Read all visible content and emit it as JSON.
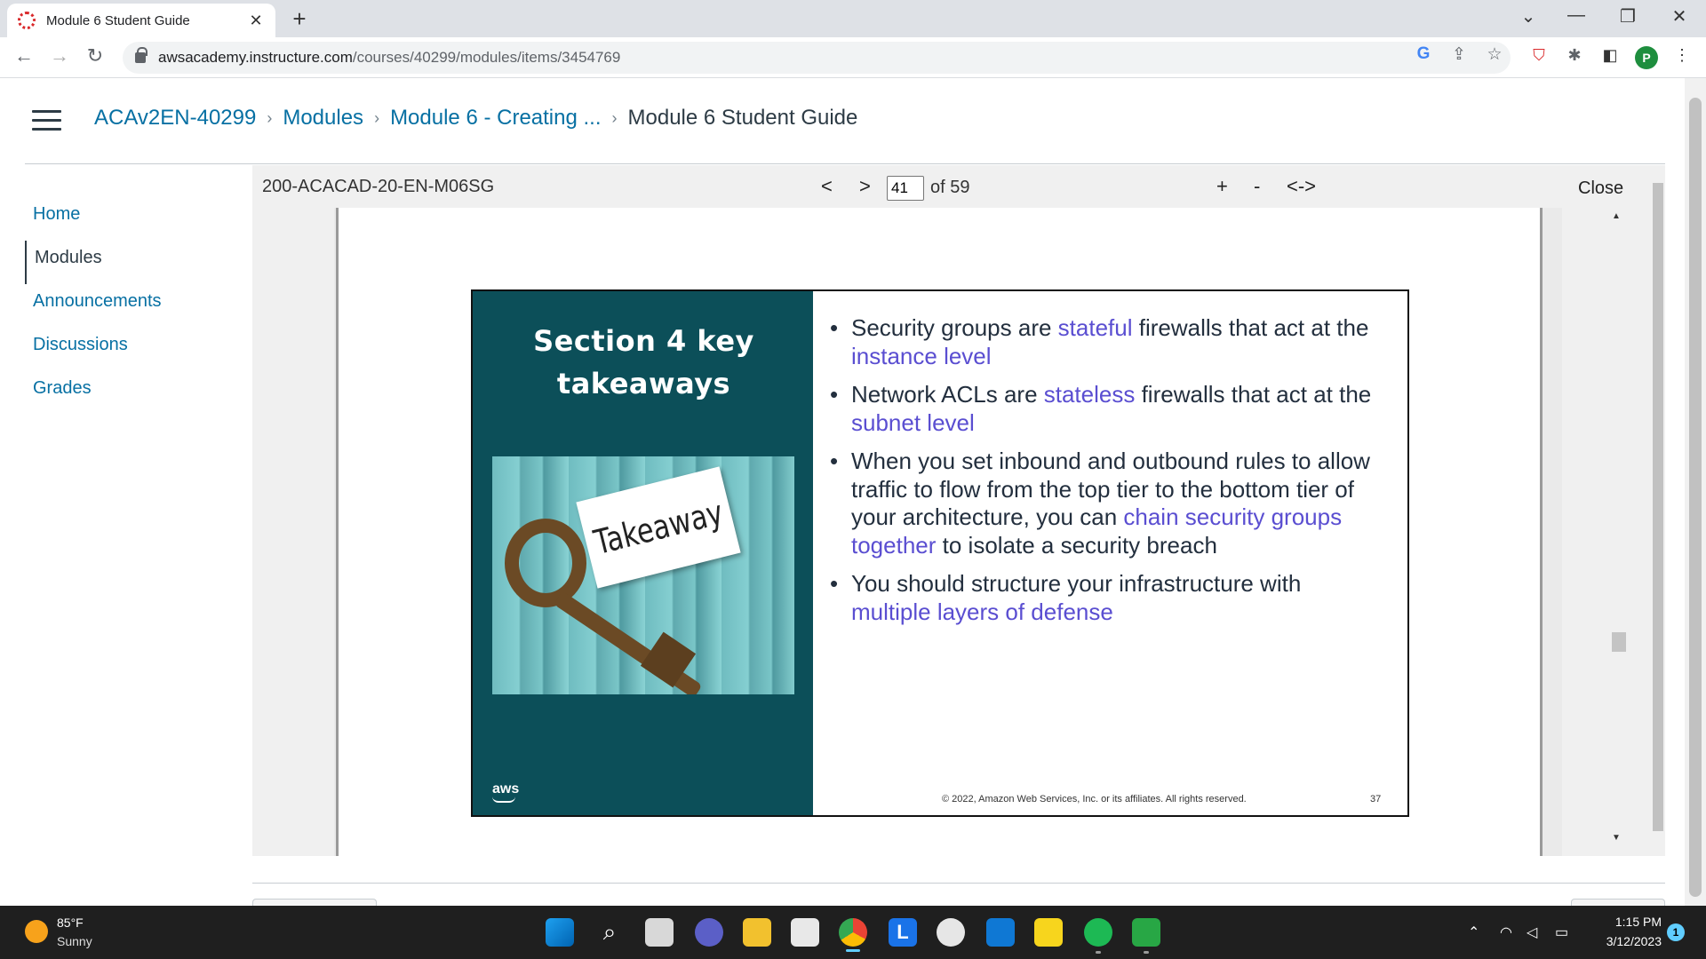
{
  "browser": {
    "tab_title": "Module 6 Student Guide",
    "tab_close": "✕",
    "new_tab": "+",
    "url_host": "awsacademy.instructure.com",
    "url_path": "/courses/40299/modules/items/3454769",
    "profile_initial": "P"
  },
  "breadcrumb": {
    "course": "ACAv2EN-40299",
    "modules": "Modules",
    "module": "Module 6 - Creating ...",
    "current": "Module 6 Student Guide",
    "separator": "›"
  },
  "sidebar": {
    "items": [
      {
        "label": "Home"
      },
      {
        "label": "Modules"
      },
      {
        "label": "Announcements"
      },
      {
        "label": "Discussions"
      },
      {
        "label": "Grades"
      }
    ]
  },
  "viewer": {
    "doc_name": "200-ACACAD-20-EN-M06SG",
    "prev": "<",
    "next": ">",
    "page": "41",
    "of_total": "of 59",
    "zoom_in": "+",
    "zoom_out": "-",
    "fit": "<->",
    "close": "Close"
  },
  "slide": {
    "title": "Section 4 key takeaways",
    "image_tag": "Takeaway",
    "logo": "aws",
    "bullets": [
      {
        "parts": [
          "Security groups are ",
          "stateful",
          " firewalls that act at the ",
          "instance level",
          ""
        ]
      },
      {
        "parts": [
          "Network ACLs are ",
          "stateless",
          " firewalls that act at the ",
          "subnet level",
          ""
        ]
      },
      {
        "parts": [
          "When you set inbound and outbound rules to allow traffic to flow from the top tier to the bottom tier of your architecture, you can ",
          "chain security groups together",
          " to isolate a security breach",
          "",
          ""
        ]
      },
      {
        "parts": [
          "You should structure your infrastructure with ",
          "multiple layers of defense",
          "",
          "",
          ""
        ]
      }
    ],
    "copyright": "© 2022, Amazon Web Services, Inc. or its affiliates. All rights reserved.",
    "slide_number": "37",
    "colors": {
      "panel": "#0c4f59",
      "highlight": "#5a4ed1",
      "text": "#232f3e"
    }
  },
  "taskbar": {
    "temperature": "85°F",
    "condition": "Sunny",
    "time": "1:15 PM",
    "date": "3/12/2023",
    "notifications": "1"
  }
}
